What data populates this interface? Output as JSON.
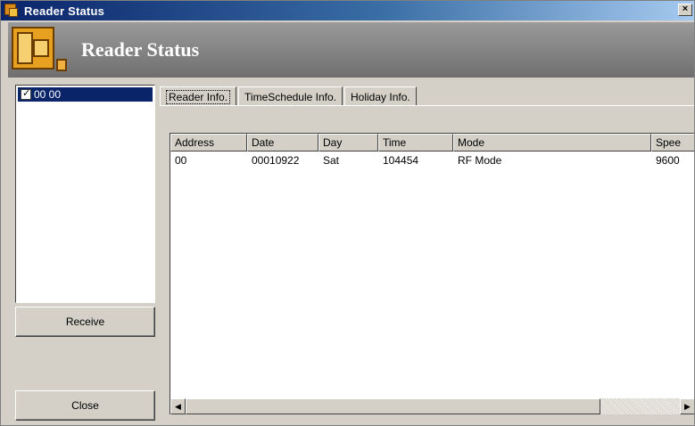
{
  "window": {
    "title": "Reader Status",
    "close_glyph": "×",
    "icons": {
      "app": "reader-app-icon",
      "close": "close-icon"
    }
  },
  "banner": {
    "title": "Reader Status",
    "icon": "reader-status-icon"
  },
  "readers": {
    "items": [
      {
        "label": "00 00",
        "checked": true,
        "selected": true
      }
    ]
  },
  "buttons": {
    "receive": "Receive",
    "close": "Close"
  },
  "tabs": [
    {
      "label": "Reader Info.",
      "active": true
    },
    {
      "label": "TimeSchedule Info.",
      "active": false
    },
    {
      "label": "Holiday Info.",
      "active": false
    }
  ],
  "table": {
    "columns": [
      "Address",
      "Date",
      "Day",
      "Time",
      "Mode",
      "Spee"
    ],
    "rows": [
      [
        "00",
        "00010922",
        "Sat",
        "104454",
        "RF Mode",
        "9600"
      ]
    ]
  },
  "scrollbar": {
    "left_arrow": "◀",
    "right_arrow": "▶"
  }
}
